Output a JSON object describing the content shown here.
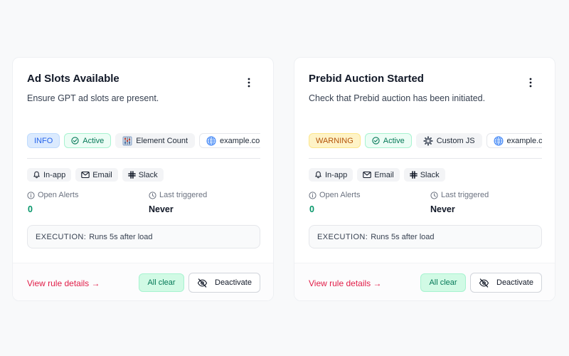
{
  "cards": [
    {
      "title": "Ad Slots Available",
      "description": "Ensure GPT ad slots are present.",
      "level": "INFO",
      "status": "Active",
      "rule_type": "Element Count",
      "rule_type_icon": "abacus-icon",
      "domain": "example.com",
      "channels": [
        {
          "label": "In-app",
          "icon": "bell-icon"
        },
        {
          "label": "Email",
          "icon": "mail-icon"
        },
        {
          "label": "Slack",
          "icon": "slack-icon"
        }
      ],
      "open_alerts_label": "Open Alerts",
      "open_alerts_value": "0",
      "last_triggered_label": "Last triggered",
      "last_triggered_value": "Never",
      "execution_key": "EXECUTION:",
      "execution_value": "Runs 5s after load",
      "view_link": "View rule details →",
      "all_clear": "All clear",
      "deactivate": "Deactivate"
    },
    {
      "title": "Prebid Auction Started",
      "description": "Check that Prebid auction has been initiated.",
      "level": "WARNING",
      "status": "Active",
      "rule_type": "Custom JS",
      "rule_type_icon": "gear-icon",
      "domain": "example.com",
      "channels": [
        {
          "label": "In-app",
          "icon": "bell-icon"
        },
        {
          "label": "Email",
          "icon": "mail-icon"
        },
        {
          "label": "Slack",
          "icon": "slack-icon"
        }
      ],
      "open_alerts_label": "Open Alerts",
      "open_alerts_value": "0",
      "last_triggered_label": "Last triggered",
      "last_triggered_value": "Never",
      "execution_key": "EXECUTION:",
      "execution_value": "Runs 5s after load",
      "view_link": "View rule details →",
      "all_clear": "All clear",
      "deactivate": "Deactivate"
    }
  ],
  "colors": {
    "page_bg": "#f8f9fa",
    "info": "#2563eb",
    "warning": "#b45309",
    "active": "#047857",
    "link": "#e11d48"
  }
}
